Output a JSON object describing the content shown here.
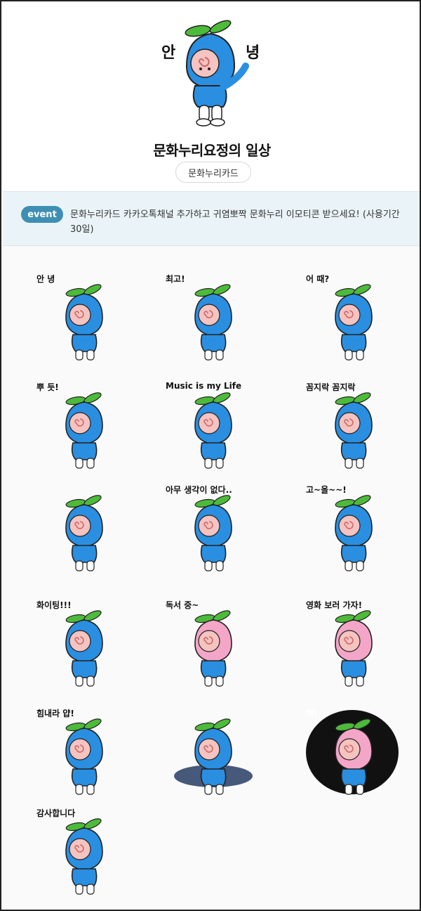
{
  "header": {
    "hero_left_text": "안",
    "hero_right_text": "녕",
    "title": "문화누리요정의 일상",
    "tag": "문화누리카드"
  },
  "event": {
    "badge": "event",
    "text": "문화누리카드 카카오톡채널 추가하고 귀염뽀짝 문화누리 이모티콘 받으세요! (사용기간 30일)"
  },
  "stickers": [
    {
      "caption": "안 녕"
    },
    {
      "caption": "최고!"
    },
    {
      "caption": "어 때?"
    },
    {
      "caption": "뿌 듯!"
    },
    {
      "caption": "Music is my Life"
    },
    {
      "caption": "꼼지락 꼼지락"
    },
    {
      "caption": ""
    },
    {
      "caption": "아무 생각이 없다.."
    },
    {
      "caption": "고~올~~!"
    },
    {
      "caption": "화이팅!!!"
    },
    {
      "caption": "독서 중~"
    },
    {
      "caption": "영화 보러 가자!"
    },
    {
      "caption": "힘내라 얍!"
    },
    {
      "caption": ""
    },
    {
      "caption": "헉!"
    },
    {
      "caption": "감사합니다"
    }
  ],
  "colors": {
    "fairy_blue": "#2a8fe0",
    "leaf_green": "#4dbb3a",
    "face_pink": "#f5c3c0",
    "event_badge": "#3e8fb3",
    "event_bg": "#eaf4f8"
  }
}
